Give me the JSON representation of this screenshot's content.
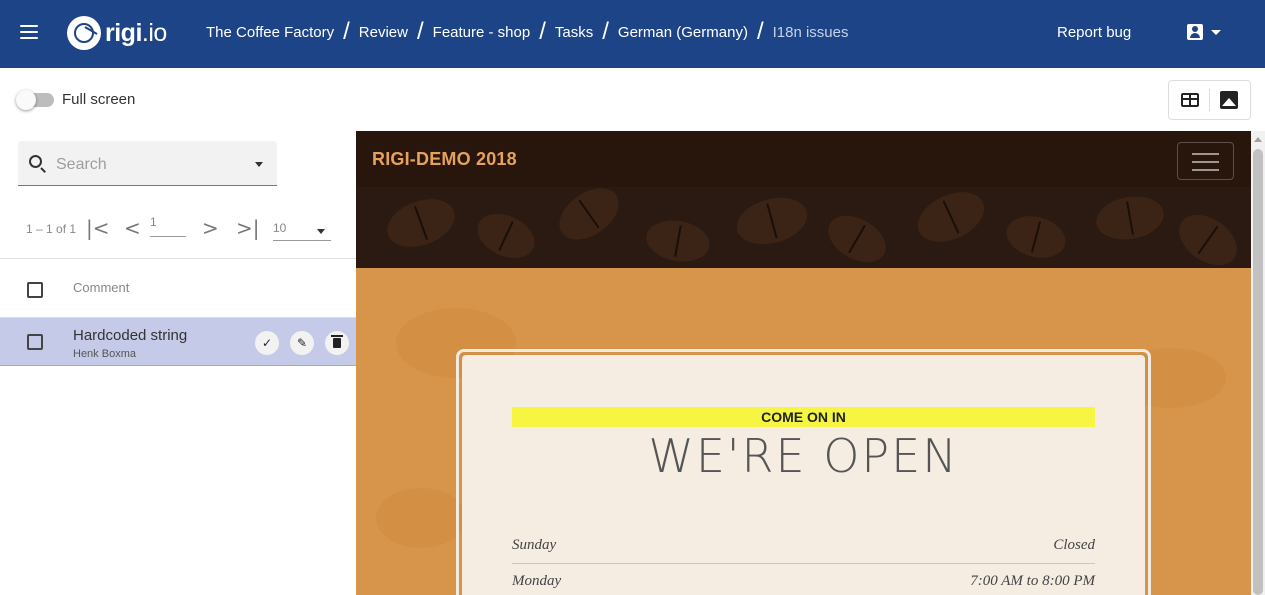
{
  "header": {
    "logo_text": "rigi",
    "logo_domain": ".io",
    "breadcrumb": [
      {
        "label": "The Coffee Factory"
      },
      {
        "label": "Review"
      },
      {
        "label": "Feature - shop"
      },
      {
        "label": "Tasks"
      },
      {
        "label": "German (Germany)"
      },
      {
        "label": "I18n issues"
      }
    ],
    "separator": "/",
    "report_bug": "Report bug",
    "icons": {
      "menu": "menu-icon",
      "account": "account-box-icon",
      "caret": "chevron-down-icon"
    },
    "background_color": "#1d4487"
  },
  "toolbar": {
    "fullscreen_label": "Full screen",
    "fullscreen_on": false,
    "view_buttons": [
      "table-icon",
      "image-icon"
    ]
  },
  "sidebar": {
    "search_placeholder": "Search",
    "pagination": {
      "range": "1 – 1 of 1",
      "page": "1",
      "page_size": "10",
      "first": "|<",
      "prev": "<",
      "next": ">",
      "last": ">|"
    },
    "column_header": "Comment",
    "rows": [
      {
        "title": "Hardcoded string",
        "author": "Henk Boxma",
        "selected": true
      }
    ],
    "row_actions": [
      "check-icon",
      "edit-pencil-icon",
      "delete-trash-icon"
    ],
    "selected_row_color": "#c5cae9"
  },
  "preview": {
    "brand": "RIGI-DEMO 2018",
    "banner": "COME ON IN",
    "heading": "WE'RE OPEN",
    "hours": [
      {
        "day": "Sunday",
        "time": "Closed"
      },
      {
        "day": "Monday",
        "time": "7:00 AM to 8:00 PM"
      }
    ],
    "accent_color": "#d6954a",
    "highlight_color": "#f5f542"
  }
}
